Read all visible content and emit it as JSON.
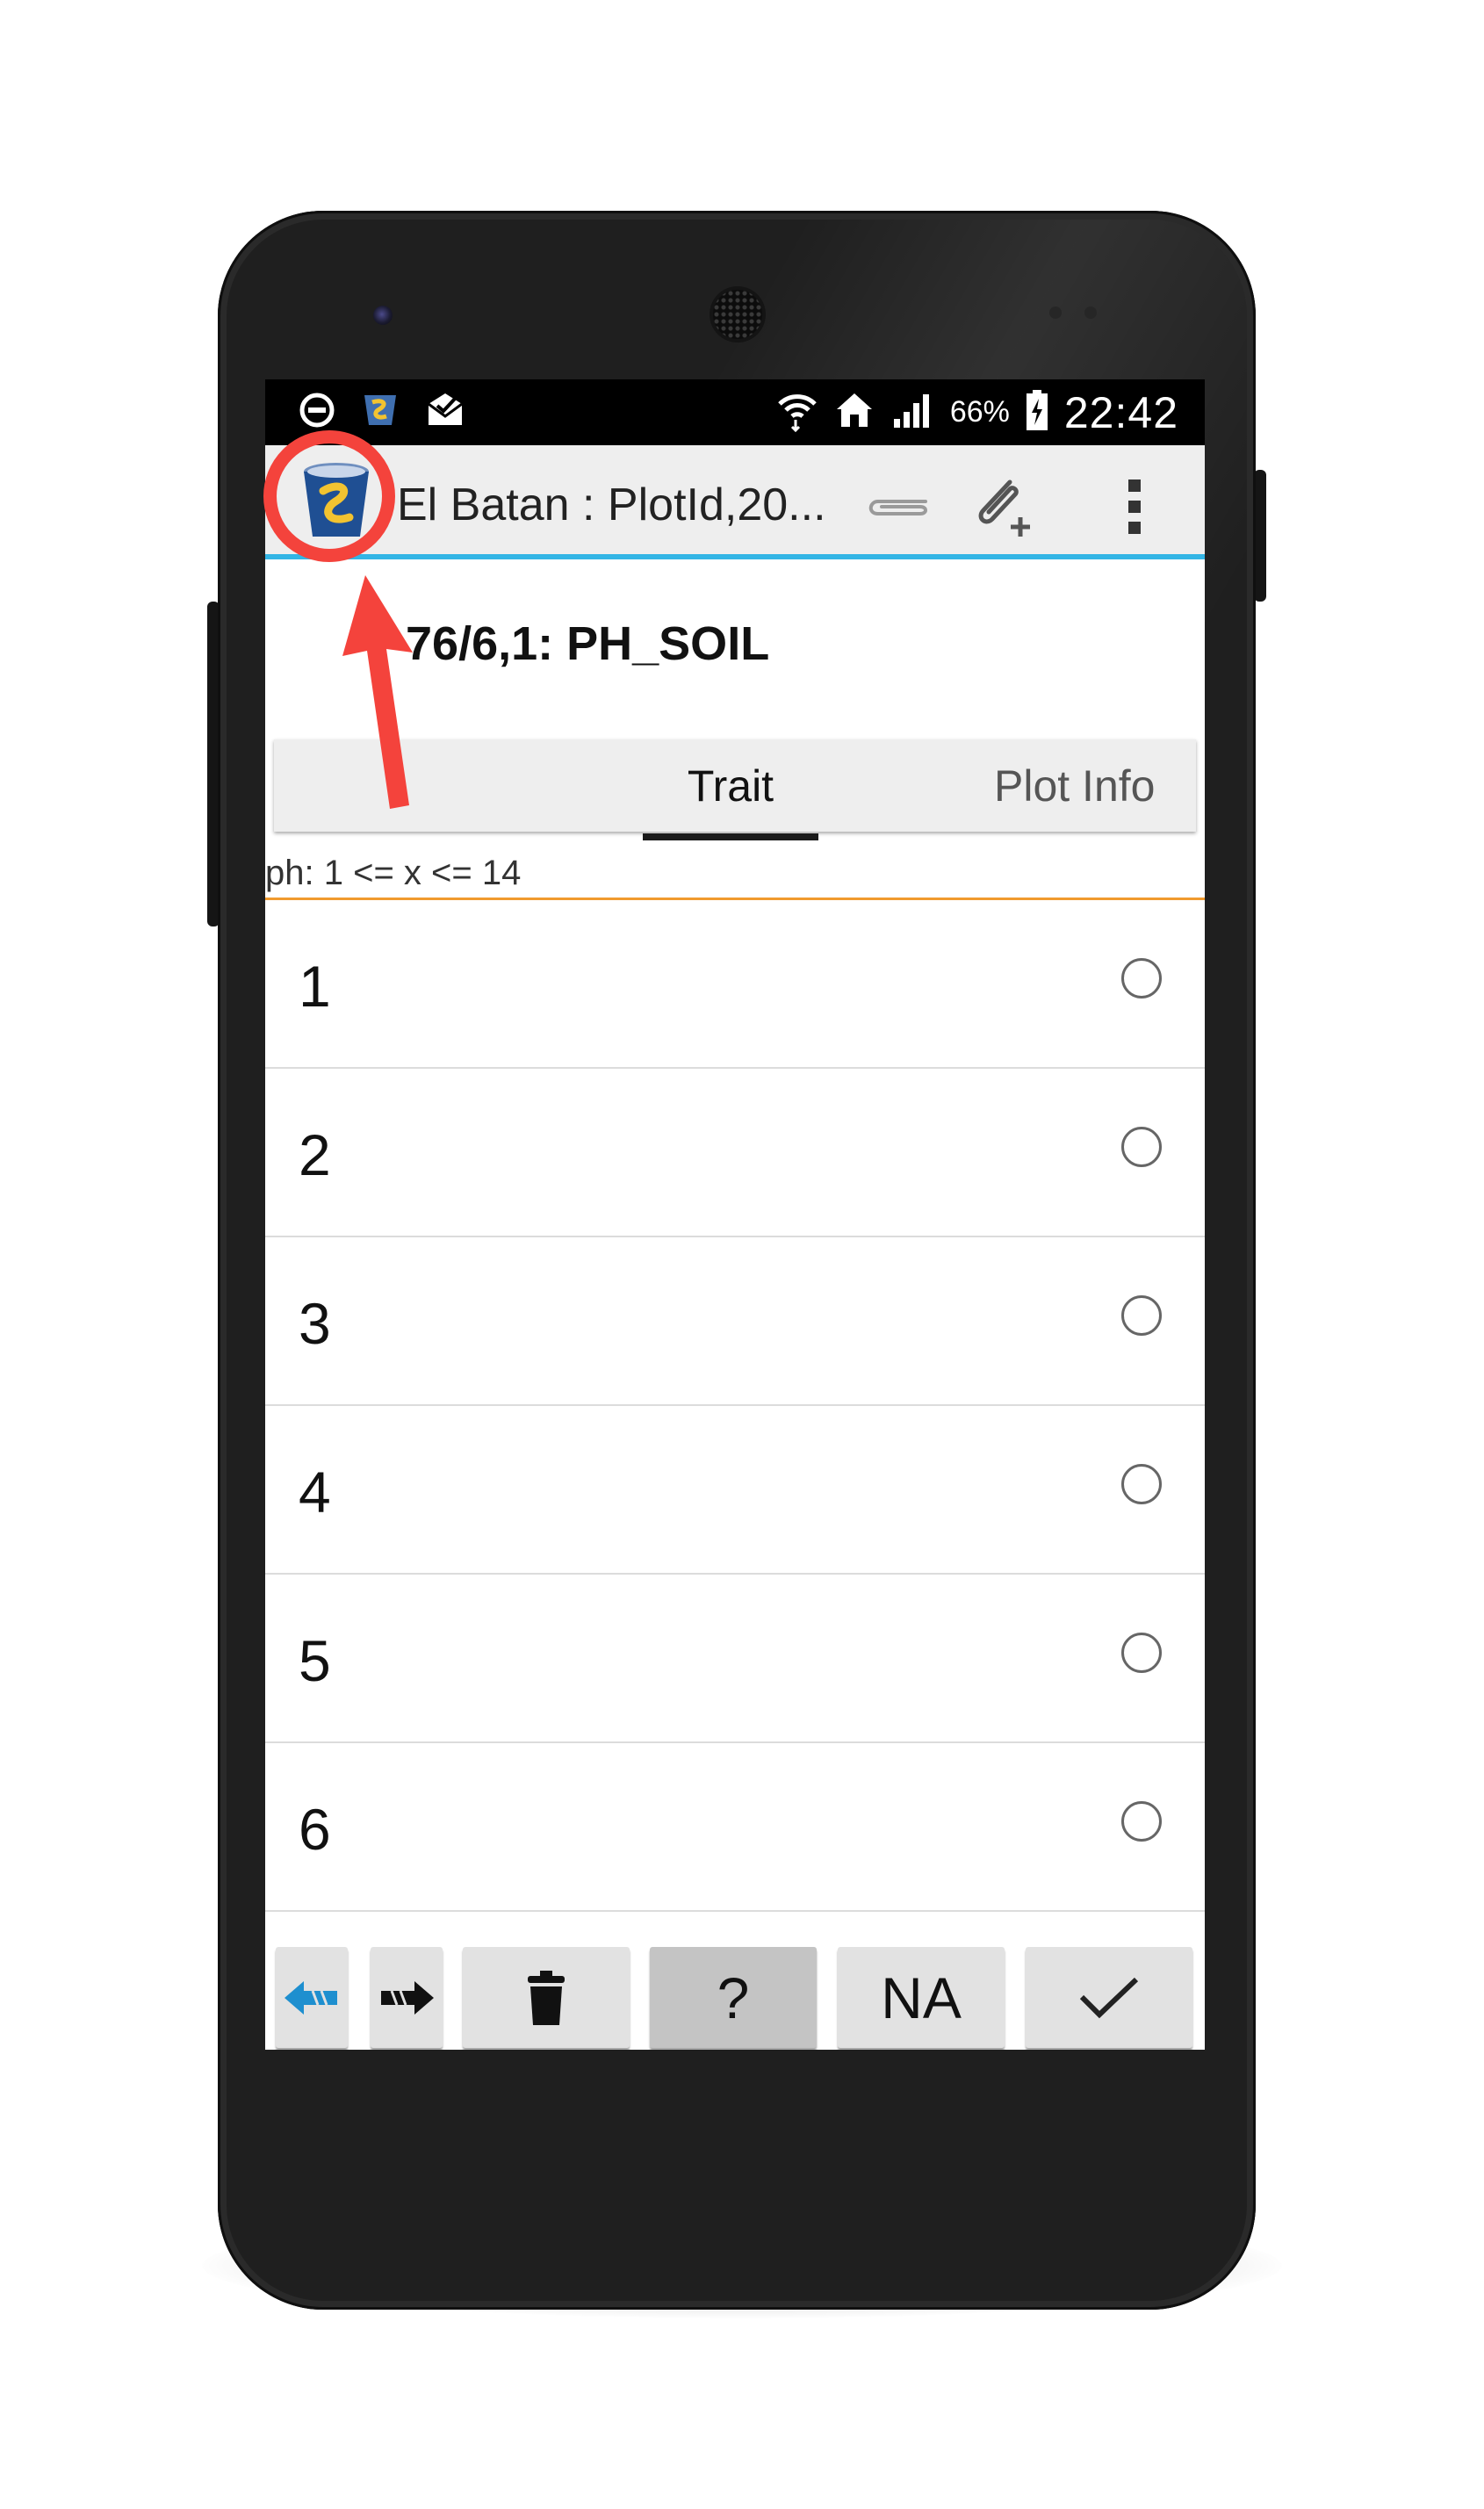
{
  "status_bar": {
    "battery_percent": "66%",
    "time": "22:42",
    "icons_left": [
      "do-not-disturb-icon",
      "app-notification-icon",
      "mail-notification-icon"
    ],
    "icons_right": [
      "wifi-icon",
      "home-icon",
      "signal-icon",
      "battery-charging-icon"
    ]
  },
  "app_bar": {
    "title": "El Batan : PlotId,20...",
    "actions": [
      "paperclip-icon",
      "attach-add-icon",
      "overflow-menu-icon"
    ]
  },
  "plot_title": "76/6,1: PH_SOIL",
  "tabs": [
    {
      "label": "Trait",
      "selected": true
    },
    {
      "label": "Plot Info",
      "selected": false
    }
  ],
  "constraint_text": "ph: 1 <= x <= 14",
  "options": [
    {
      "label": "1",
      "selected": false
    },
    {
      "label": "2",
      "selected": false
    },
    {
      "label": "3",
      "selected": false
    },
    {
      "label": "4",
      "selected": false
    },
    {
      "label": "5",
      "selected": false
    },
    {
      "label": "6",
      "selected": false
    }
  ],
  "bottom_bar": {
    "help_label": "?",
    "na_label": "NA"
  },
  "colors": {
    "accent_blue": "#33b5e5",
    "constraint_line": "#f09a2e",
    "annotation_red": "#f4433c",
    "prev_arrow": "#1e8fcf"
  }
}
